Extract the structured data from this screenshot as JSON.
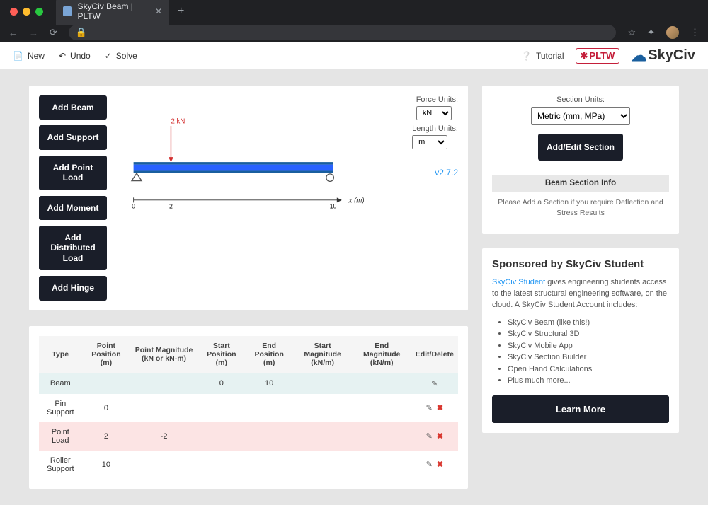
{
  "browser": {
    "tab_title": "SkyCiv Beam | PLTW"
  },
  "toolbar": {
    "new": "New",
    "undo": "Undo",
    "solve": "Solve",
    "tutorial": "Tutorial"
  },
  "actions": {
    "add_beam": "Add Beam",
    "add_support": "Add Support",
    "add_point_load": "Add Point Load",
    "add_moment": "Add Moment",
    "add_distributed_load": "Add Distributed Load",
    "add_hinge": "Add Hinge"
  },
  "units": {
    "force_label": "Force Units:",
    "force_value": "kN",
    "length_label": "Length Units:",
    "length_value": "m"
  },
  "beam_diagram": {
    "load_text": "2 kN",
    "axis_ticks": [
      "0",
      "2",
      "10"
    ],
    "axis_label": "x (m)"
  },
  "version": "v2.7.2",
  "table": {
    "headers": [
      "Type",
      "Point Position (m)",
      "Point Magnitude (kN or kN-m)",
      "Start Position (m)",
      "End Position (m)",
      "Start Magnitude (kN/m)",
      "End Magnitude (kN/m)",
      "Edit/Delete"
    ],
    "rows": [
      {
        "type": "Beam",
        "pp": "",
        "pm": "",
        "sp": "0",
        "ep": "10",
        "sm": "",
        "em": "",
        "edit": true,
        "del": false,
        "cls": "beam-row"
      },
      {
        "type": "Pin Support",
        "pp": "0",
        "pm": "",
        "sp": "",
        "ep": "",
        "sm": "",
        "em": "",
        "edit": true,
        "del": true,
        "cls": ""
      },
      {
        "type": "Point Load",
        "pp": "2",
        "pm": "-2",
        "sp": "",
        "ep": "",
        "sm": "",
        "em": "",
        "edit": true,
        "del": true,
        "cls": "point-row"
      },
      {
        "type": "Roller Support",
        "pp": "10",
        "pm": "",
        "sp": "",
        "ep": "",
        "sm": "",
        "em": "",
        "edit": true,
        "del": true,
        "cls": ""
      }
    ]
  },
  "section": {
    "units_label": "Section Units:",
    "units_value": "Metric (mm, MPa)",
    "add_edit": "Add/Edit Section",
    "info_title": "Beam Section Info",
    "info_body": "Please Add a Section if you require Deflection and Stress Results"
  },
  "sponsor": {
    "title": "Sponsored by SkyCiv Student",
    "link_text": "SkyCiv Student",
    "body_rest": " gives engineering students access to the latest structural engineering software, on the cloud. A SkyCiv Student Account includes:",
    "items": [
      "SkyCiv Beam (like this!)",
      "SkyCiv Structural 3D",
      "SkyCiv Mobile App",
      "SkyCiv Section Builder",
      "Open Hand Calculations",
      "Plus much more..."
    ],
    "learn_more": "Learn More"
  },
  "chart_data": {
    "type": "beam-diagram",
    "span_m": 10,
    "supports": [
      {
        "kind": "pin",
        "x": 0
      },
      {
        "kind": "roller",
        "x": 10
      }
    ],
    "point_loads": [
      {
        "x": 2,
        "magnitude_kN": 2,
        "direction": "down"
      }
    ],
    "x_ticks": [
      0,
      2,
      10
    ]
  }
}
